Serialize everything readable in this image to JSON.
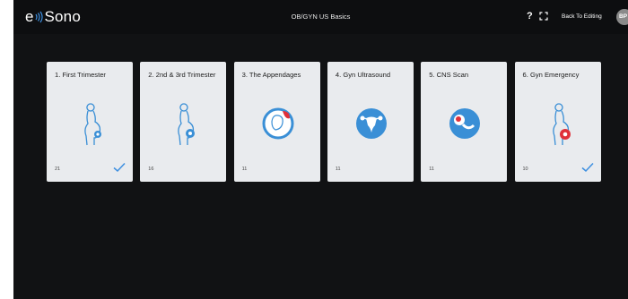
{
  "app": {
    "logo_e": "e",
    "logo_word": "Sono",
    "title": "OB/GYN US Basics",
    "help_label": "?",
    "back_label": "Back To Editing",
    "avatar_initials": "BP",
    "accent": "#3d8fe0",
    "icon_blue": "#3a8fd6",
    "icon_red": "#e0303a"
  },
  "modules": [
    {
      "name": "1. First Trimester",
      "count": "21",
      "completed": true,
      "icon": "pregnant-woman-icon"
    },
    {
      "name": "2. 2nd & 3rd Trimester",
      "count": "16",
      "completed": false,
      "icon": "pregnant-woman-icon"
    },
    {
      "name": "3. The Appendages",
      "count": "11",
      "completed": false,
      "icon": "fetus-circle-icon"
    },
    {
      "name": "4. Gyn Ultrasound",
      "count": "11",
      "completed": false,
      "icon": "uterus-icon"
    },
    {
      "name": "5. CNS Scan",
      "count": "11",
      "completed": false,
      "icon": "fetus-head-icon"
    },
    {
      "name": "6. Gyn Emergency",
      "count": "10",
      "completed": true,
      "icon": "pregnant-woman-emergency-icon"
    }
  ]
}
